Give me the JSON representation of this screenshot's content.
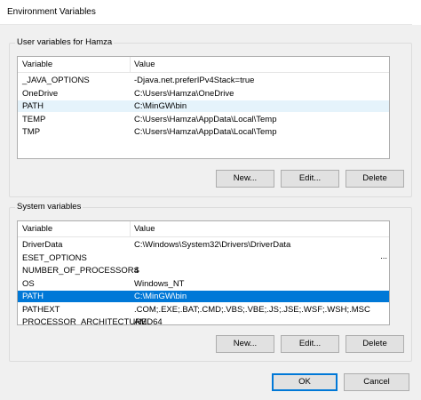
{
  "window": {
    "title": "Environment Variables"
  },
  "user_vars": {
    "group_label": "User variables for Hamza",
    "columns": [
      "Variable",
      "Value"
    ],
    "rows": [
      {
        "variable": "_JAVA_OPTIONS",
        "value": "-Djava.net.preferIPv4Stack=true"
      },
      {
        "variable": "OneDrive",
        "value": "C:\\Users\\Hamza\\OneDrive"
      },
      {
        "variable": "PATH",
        "value": "C:\\MinGW\\bin"
      },
      {
        "variable": "TEMP",
        "value": "C:\\Users\\Hamza\\AppData\\Local\\Temp"
      },
      {
        "variable": "TMP",
        "value": "C:\\Users\\Hamza\\AppData\\Local\\Temp"
      }
    ],
    "highlighted_row_index": 2,
    "buttons": {
      "new": "New...",
      "edit": "Edit...",
      "delete": "Delete"
    }
  },
  "system_vars": {
    "group_label": "System variables",
    "columns": [
      "Variable",
      "Value"
    ],
    "rows": [
      {
        "variable": "DriverData",
        "value": "C:\\Windows\\System32\\Drivers\\DriverData"
      },
      {
        "variable": "ESET_OPTIONS",
        "value": ""
      },
      {
        "variable": "NUMBER_OF_PROCESSORS",
        "value": "4"
      },
      {
        "variable": "OS",
        "value": "Windows_NT"
      },
      {
        "variable": "PATH",
        "value": "C:\\MinGW\\bin"
      },
      {
        "variable": "PATHEXT",
        "value": ".COM;.EXE;.BAT;.CMD;.VBS;.VBE;.JS;.JSE;.WSF;.WSH;.MSC"
      },
      {
        "variable": "PROCESSOR_ARCHITECTURE",
        "value": "AMD64"
      }
    ],
    "overflow_marker": "...",
    "selected_row_index": 4,
    "buttons": {
      "new": "New...",
      "edit": "Edit...",
      "delete": "Delete"
    }
  },
  "footer": {
    "ok": "OK",
    "cancel": "Cancel"
  },
  "colors": {
    "selection": "#0078d7",
    "hover": "#e5f3fb"
  }
}
